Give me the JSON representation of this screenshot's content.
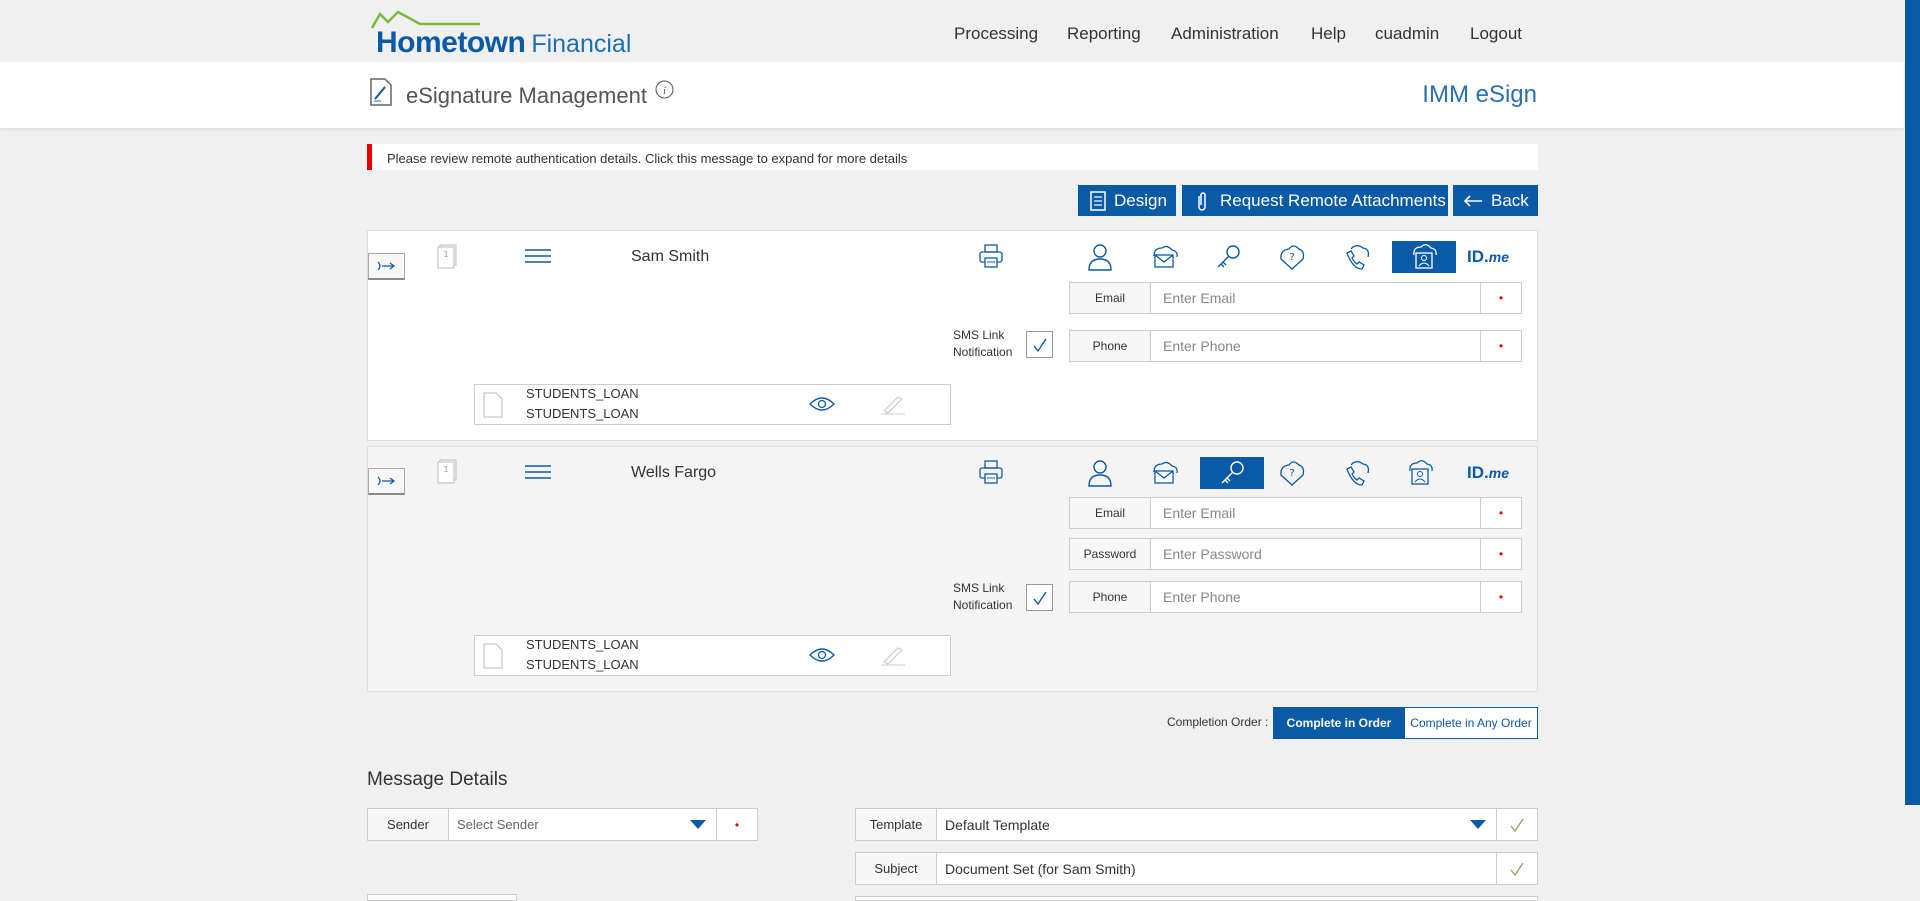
{
  "header": {
    "logo_main": "Hometown",
    "logo_sub": "Financial",
    "nav": [
      "Processing",
      "Reporting",
      "Administration",
      "Help",
      "cuadmin",
      "Logout"
    ]
  },
  "title_band": {
    "page_title": "eSignature Management",
    "brand": "IMM eSign"
  },
  "alert": {
    "message": "Please review remote authentication details. Click this message to expand for more details"
  },
  "actions": {
    "design": "Design",
    "request_attachments": "Request Remote Attachments",
    "back": "Back"
  },
  "signers": [
    {
      "name": "Sam Smith",
      "active_auth": "id-card",
      "idme_main": "ID.",
      "idme_sub": "me",
      "fields": [
        {
          "label": "Email",
          "placeholder": "Enter Email",
          "value": ""
        },
        {
          "label": "Phone",
          "placeholder": "Enter Phone",
          "value": ""
        }
      ],
      "sms_line1": "SMS Link",
      "sms_line2": "Notification",
      "sms_checked": true,
      "documents": [
        "STUDENTS_LOAN",
        "STUDENTS_LOAN"
      ]
    },
    {
      "name": "Wells Fargo",
      "active_auth": "key",
      "idme_main": "ID.",
      "idme_sub": "me",
      "fields": [
        {
          "label": "Email",
          "placeholder": "Enter Email",
          "value": ""
        },
        {
          "label": "Password",
          "placeholder": "Enter Password",
          "value": ""
        },
        {
          "label": "Phone",
          "placeholder": "Enter Phone",
          "value": ""
        }
      ],
      "sms_line1": "SMS Link",
      "sms_line2": "Notification",
      "sms_checked": true,
      "documents": [
        "STUDENTS_LOAN",
        "STUDENTS_LOAN"
      ]
    }
  ],
  "completion": {
    "label": "Completion Order :",
    "options": [
      "Complete in Order",
      "Complete in Any Order"
    ],
    "selected": "Complete in Order"
  },
  "message_details": {
    "title": "Message Details",
    "sender_label": "Sender",
    "sender_placeholder": "Select Sender",
    "template_label": "Template",
    "template_value": "Default Template",
    "subject_label": "Subject",
    "subject_value": "Document Set (for Sam Smith)"
  },
  "colors": {
    "brand_blue": "#0b5aa6",
    "logo_green": "#7ab93a",
    "alert_red": "#e00000"
  }
}
